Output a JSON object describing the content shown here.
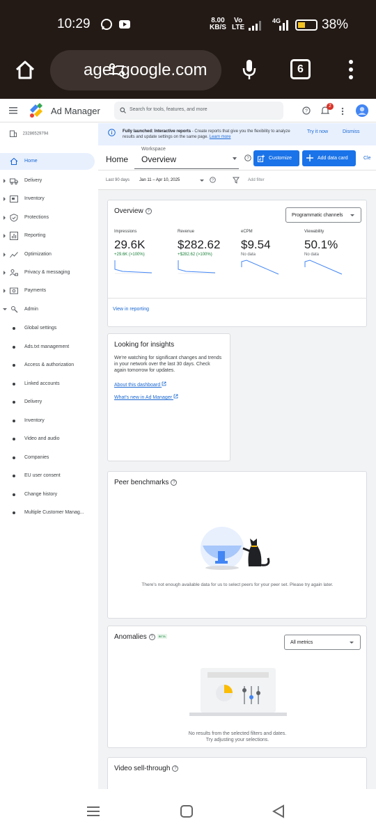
{
  "status_bar": {
    "time": "10:29",
    "speed_top": "8.00",
    "speed_bottom": "KB/S",
    "volte_top": "Vo",
    "volte_bottom": "LTE",
    "network_label": "4G",
    "battery_pct": "38%",
    "battery_level": 0.38
  },
  "browser": {
    "url": "ager.google.com",
    "tab_count": "6"
  },
  "app": {
    "name": "Ad Manager",
    "search_placeholder": "Search for tools, features, and more",
    "notification_count": "2"
  },
  "sidebar": {
    "network_id": "23286529794",
    "items": [
      {
        "label": "Home",
        "icon": "home-icon",
        "active": true
      },
      {
        "label": "Delivery",
        "icon": "truck-icon"
      },
      {
        "label": "Inventory",
        "icon": "inventory-icon"
      },
      {
        "label": "Protections",
        "icon": "shield-icon"
      },
      {
        "label": "Reporting",
        "icon": "reporting-icon"
      },
      {
        "label": "Optimization",
        "icon": "trend-icon"
      },
      {
        "label": "Privacy & messaging",
        "icon": "privacy-icon"
      },
      {
        "label": "Payments",
        "icon": "payments-icon"
      },
      {
        "label": "Admin",
        "icon": "admin-icon"
      }
    ],
    "admin_subitems": [
      "Global settings",
      "Ads.txt management",
      "Access & authorization",
      "Linked accounts",
      "Delivery",
      "Inventory",
      "Video and audio",
      "Companies",
      "EU user consent",
      "Change history",
      "Multiple Customer Manag..."
    ]
  },
  "banner": {
    "title": "Fully launched: Interactive reports",
    "text": " - Create reports that give you the flexibility to analyze results and update settings on the same page. ",
    "link": "Learn more",
    "try_label": "Try it now",
    "dismiss_label": "Dismiss"
  },
  "toolbar": {
    "home": "Home",
    "workspace_label": "Workspace",
    "workspace_value": "Overview",
    "customize_label": "Customize",
    "add_card_label": "Add data card",
    "clear_label": "Cle"
  },
  "filters": {
    "date_label": "Last 90 days",
    "date_value": "Jan 11 – Apr 10, 2025",
    "add_filter": "Add filter"
  },
  "overview": {
    "title": "Overview",
    "channel_select": "Programmatic channels",
    "metrics": [
      {
        "label": "Impressions",
        "value": "29.6K",
        "delta": "+29.6K (>100%)",
        "positive": true
      },
      {
        "label": "Revenue",
        "value": "$282.62",
        "delta": "+$282.62 (>100%)",
        "positive": true
      },
      {
        "label": "eCPM",
        "value": "$9.54",
        "delta": "No data",
        "positive": false
      },
      {
        "label": "Viewability",
        "value": "50.1%",
        "delta": "No data",
        "positive": false
      }
    ],
    "view_link": "View in reporting"
  },
  "insights": {
    "title": "Looking for insights",
    "body": "We're watching for significant changes and trends in your network over the last 30 days. Check again tomorrow for updates.",
    "link1": "About this dashboard",
    "link2": "What's new in Ad Manager"
  },
  "peer": {
    "title": "Peer benchmarks",
    "message": "There's not enough available data for us to select peers for your peer set. Please try again later."
  },
  "anomalies": {
    "title": "Anomalies",
    "beta": "BETA",
    "metric_select": "All metrics",
    "msg1": "No results from the selected filters and dates.",
    "msg2": "Try adjusting your selections."
  },
  "video": {
    "title": "Video sell-through"
  },
  "colors": {
    "accent": "#1a73e8",
    "positive": "#188038",
    "sidebar_active": "#e8f0fe"
  }
}
